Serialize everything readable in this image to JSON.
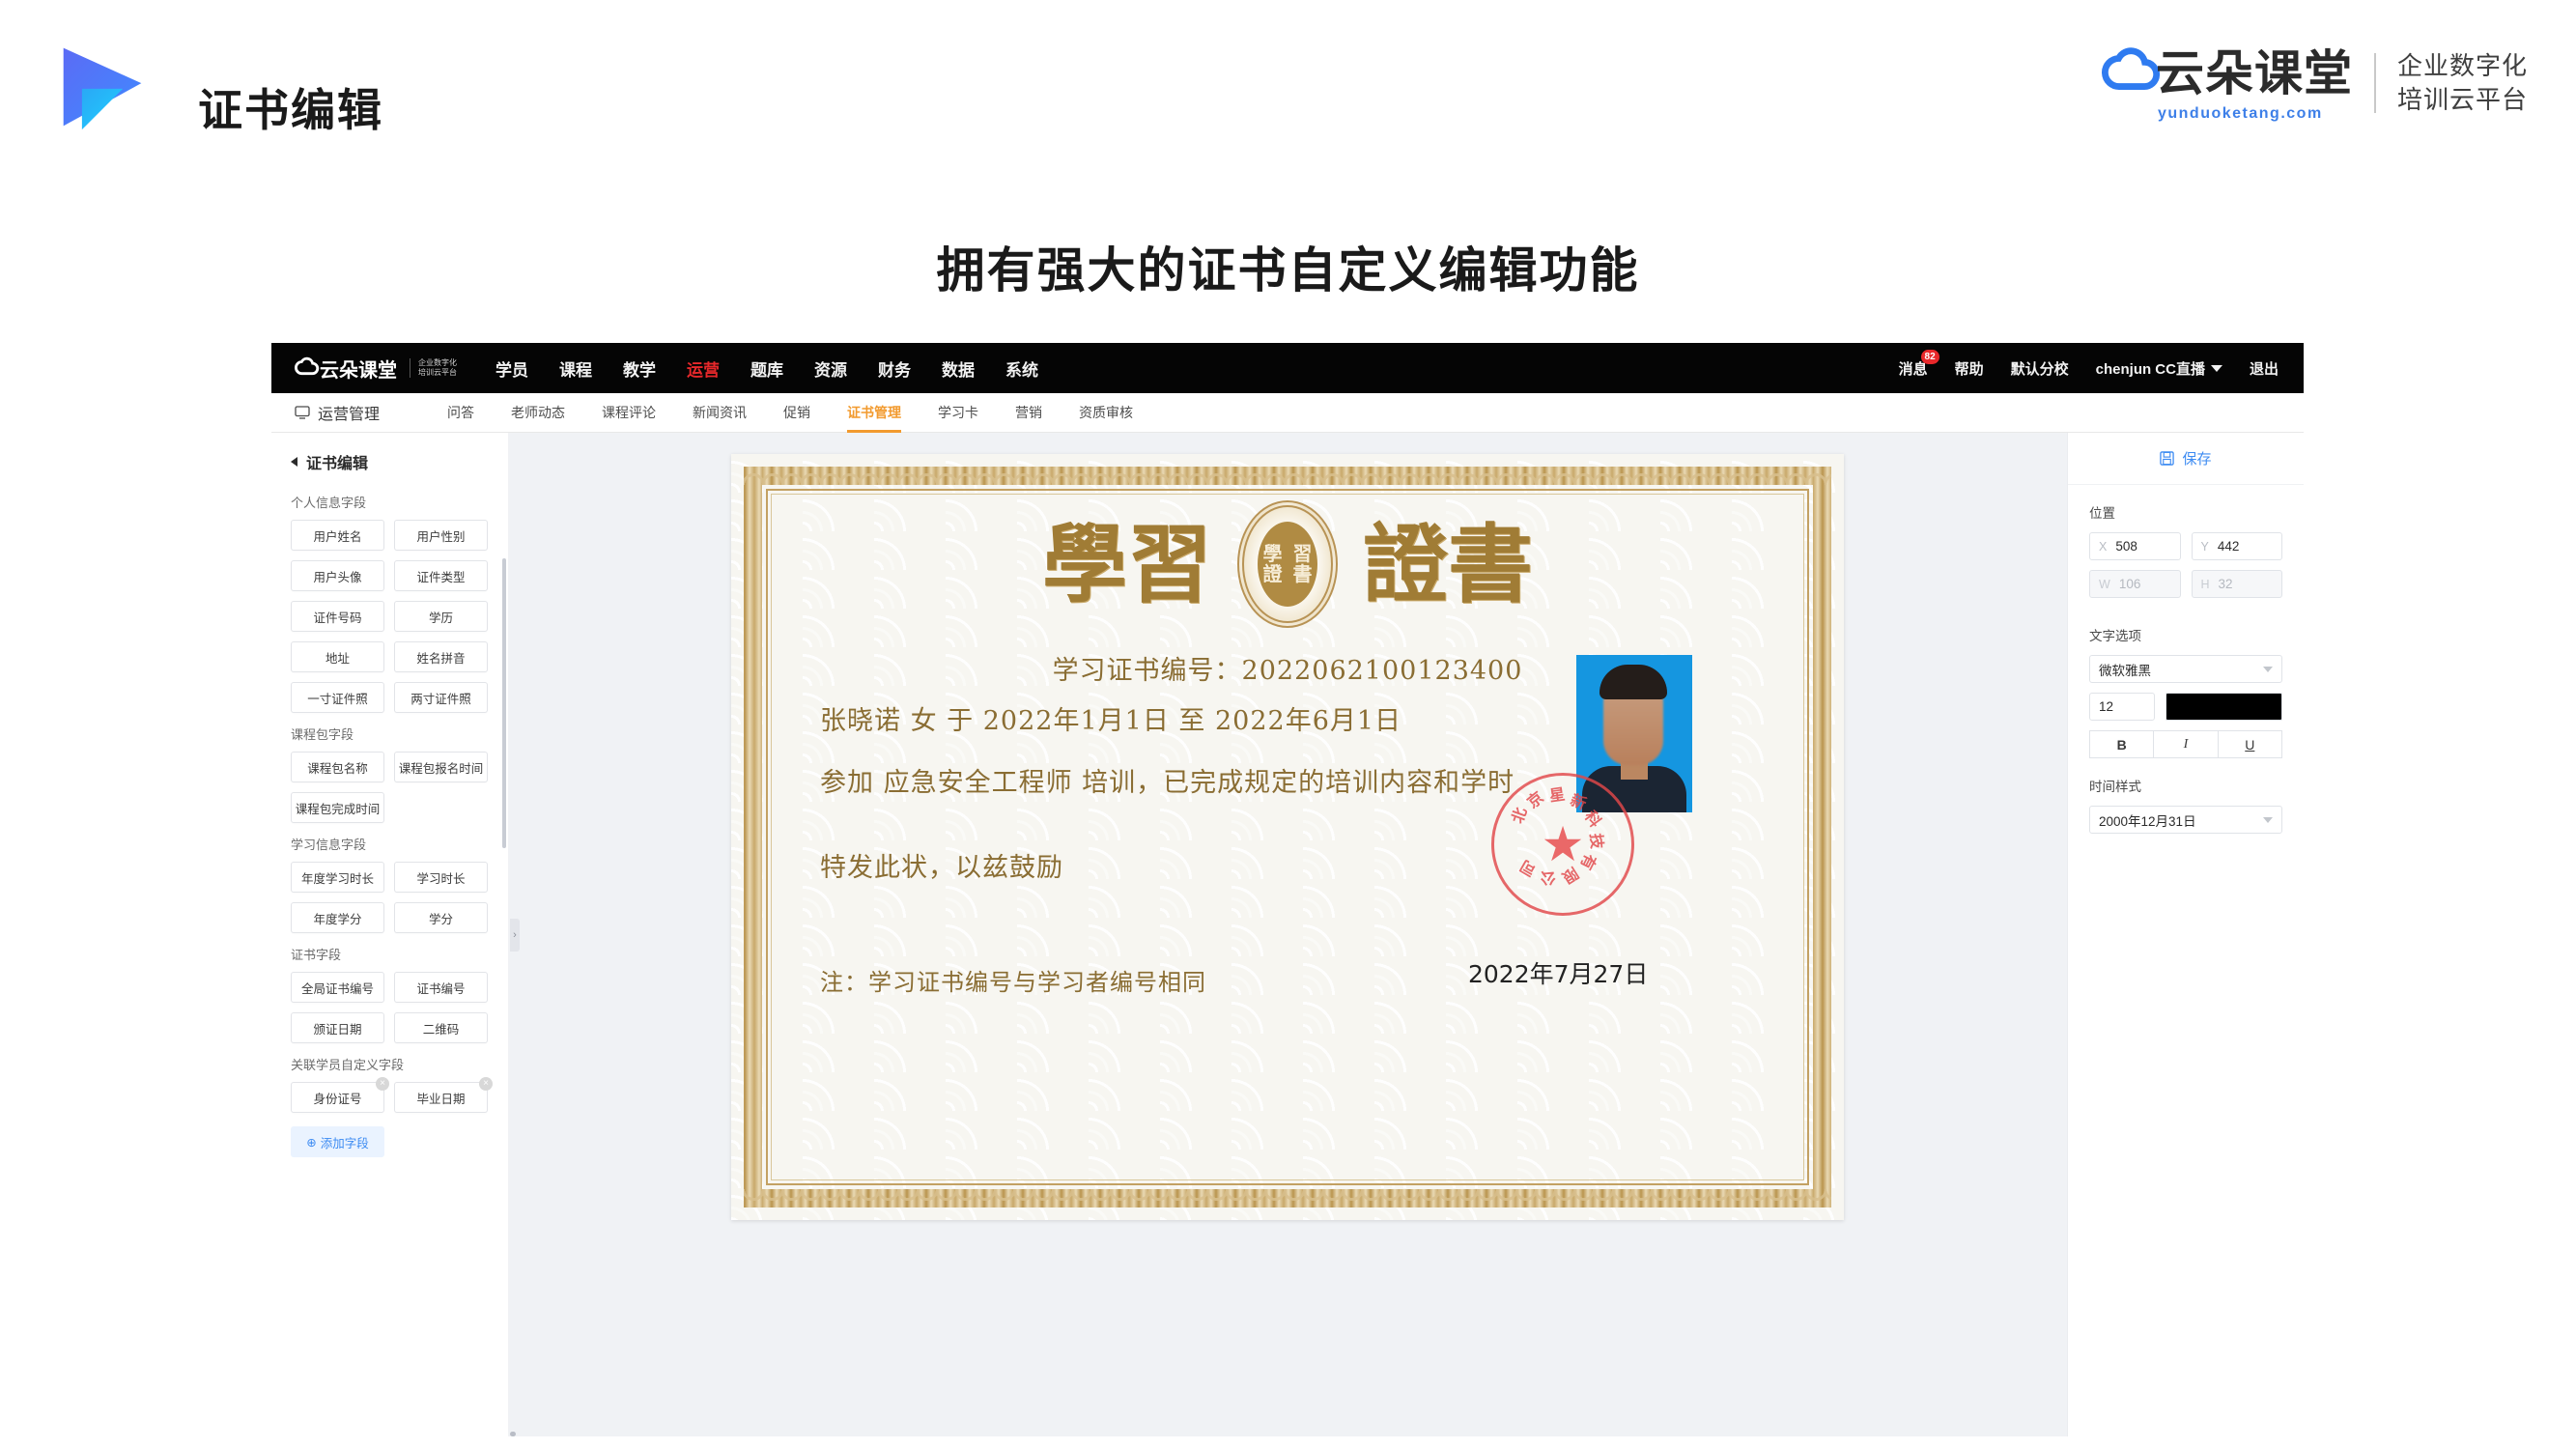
{
  "header": {
    "title": "证书编辑",
    "logo_cn": "云朵课堂",
    "logo_url": "yunduoketang.com",
    "tagline_line1": "企业数字化",
    "tagline_line2": "培训云平台"
  },
  "section_heading": "拥有强大的证书自定义编辑功能",
  "topbar": {
    "logo_cn": "云朵课堂",
    "logo_sub_line1": "企业数字化",
    "logo_sub_line2": "培训云平台",
    "nav": [
      {
        "label": "学员",
        "active": false
      },
      {
        "label": "课程",
        "active": false
      },
      {
        "label": "教学",
        "active": false
      },
      {
        "label": "运营",
        "active": true
      },
      {
        "label": "题库",
        "active": false
      },
      {
        "label": "资源",
        "active": false
      },
      {
        "label": "财务",
        "active": false
      },
      {
        "label": "数据",
        "active": false
      },
      {
        "label": "系统",
        "active": false
      }
    ],
    "messages_label": "消息",
    "messages_badge": "82",
    "help_label": "帮助",
    "branch_label": "默认分校",
    "account_label": "chenjun CC直播",
    "logout_label": "退出"
  },
  "subbar": {
    "module_label": "运营管理",
    "tabs": [
      {
        "label": "问答",
        "active": false
      },
      {
        "label": "老师动态",
        "active": false
      },
      {
        "label": "课程评论",
        "active": false
      },
      {
        "label": "新闻资讯",
        "active": false
      },
      {
        "label": "促销",
        "active": false
      },
      {
        "label": "证书管理",
        "active": true
      },
      {
        "label": "学习卡",
        "active": false
      },
      {
        "label": "营销",
        "active": false
      },
      {
        "label": "资质审核",
        "active": false
      }
    ]
  },
  "sidebar": {
    "title": "证书编辑",
    "groups": [
      {
        "title": "个人信息字段",
        "fields": [
          {
            "label": "用户姓名",
            "removable": false
          },
          {
            "label": "用户性别",
            "removable": false
          },
          {
            "label": "用户头像",
            "removable": false
          },
          {
            "label": "证件类型",
            "removable": false
          },
          {
            "label": "证件号码",
            "removable": false
          },
          {
            "label": "学历",
            "removable": false
          },
          {
            "label": "地址",
            "removable": false
          },
          {
            "label": "姓名拼音",
            "removable": false
          },
          {
            "label": "一寸证件照",
            "removable": false
          },
          {
            "label": "两寸证件照",
            "removable": false
          }
        ]
      },
      {
        "title": "课程包字段",
        "fields": [
          {
            "label": "课程包名称",
            "removable": false
          },
          {
            "label": "课程包报名时间",
            "removable": false
          },
          {
            "label": "课程包完成时间",
            "removable": false
          }
        ]
      },
      {
        "title": "学习信息字段",
        "fields": [
          {
            "label": "年度学习时长",
            "removable": false
          },
          {
            "label": "学习时长",
            "removable": false
          },
          {
            "label": "年度学分",
            "removable": false
          },
          {
            "label": "学分",
            "removable": false
          }
        ]
      },
      {
        "title": "证书字段",
        "fields": [
          {
            "label": "全局证书编号",
            "removable": false
          },
          {
            "label": "证书编号",
            "removable": false
          },
          {
            "label": "颁证日期",
            "removable": false
          },
          {
            "label": "二维码",
            "removable": false
          }
        ]
      },
      {
        "title": "关联学员自定义字段",
        "fields": [
          {
            "label": "身份证号",
            "removable": true
          },
          {
            "label": "毕业日期",
            "removable": true
          }
        ]
      }
    ],
    "add_field_label": "添加字段"
  },
  "certificate": {
    "title_left": "學習",
    "title_right": "證書",
    "seal_chars": "學習證書",
    "cert_no_line": "学习证书编号：2022062100123400",
    "line1": "张晓诺  女  于 2022年1月1日 至 2022年6月1日",
    "line2": "参加  应急安全工程师  培训，已完成规定的培训内容和学时",
    "line3": "特发此状，以兹鼓励",
    "note": "注：学习证书编号与学习者编号相同",
    "issue_date": "2022年7月27日",
    "stamp_text": "北京星新科技有限公司",
    "stamp_star": "★"
  },
  "right_panel": {
    "save_label": "保存",
    "position_label": "位置",
    "position": {
      "x_key": "X",
      "x_value": "508",
      "y_key": "Y",
      "y_value": "442",
      "w_key": "W",
      "w_value": "106",
      "h_key": "H",
      "h_value": "32"
    },
    "text_options_label": "文字选项",
    "font_family": "微软雅黑",
    "font_size": "12",
    "font_color": "#000000",
    "bold_label": "B",
    "italic_label": "I",
    "underline_label": "U",
    "time_style_label": "时间样式",
    "time_style_value": "2000年12月31日"
  },
  "accent": {
    "red": "#e8282b",
    "orange": "#f29a2e",
    "blue": "#3d8bf2",
    "gold": "#a07c35",
    "stamp_red": "#e2484a"
  }
}
